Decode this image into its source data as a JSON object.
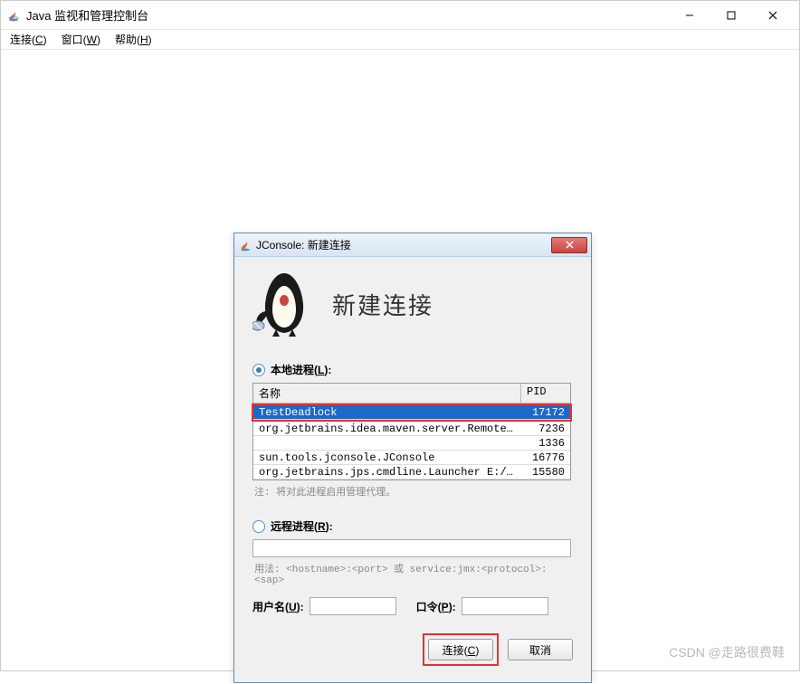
{
  "main_window": {
    "title": "Java 监视和管理控制台"
  },
  "menubar": {
    "connect": "连接(C)",
    "window": "窗口(W)",
    "help": "帮助(H)"
  },
  "dialog": {
    "title": "JConsole: 新建连接",
    "header": "新建连接",
    "local": {
      "label": "本地进程(L):",
      "columns": {
        "name": "名称",
        "pid": "PID"
      },
      "rows": [
        {
          "name": "TestDeadlock",
          "pid": "17172",
          "selected": true,
          "highlighted": true
        },
        {
          "name": "org.jetbrains.idea.maven.server.RemoteMave...",
          "pid": "7236"
        },
        {
          "name": "",
          "pid": "1336"
        },
        {
          "name": "sun.tools.jconsole.JConsole",
          "pid": "16776"
        },
        {
          "name": "org.jetbrains.jps.cmdline.Launcher E:/idea...",
          "pid": "15580"
        }
      ],
      "note": "注: 将对此进程启用管理代理。"
    },
    "remote": {
      "label": "远程进程(R):",
      "usage": "用法: <hostname>:<port> 或 service:jmx:<protocol>:<sap>"
    },
    "credentials": {
      "username_label": "用户名(U):",
      "password_label": "口令(P):"
    },
    "buttons": {
      "connect": "连接(C)",
      "cancel": "取消"
    }
  },
  "watermark": "CSDN @走路很费鞋"
}
